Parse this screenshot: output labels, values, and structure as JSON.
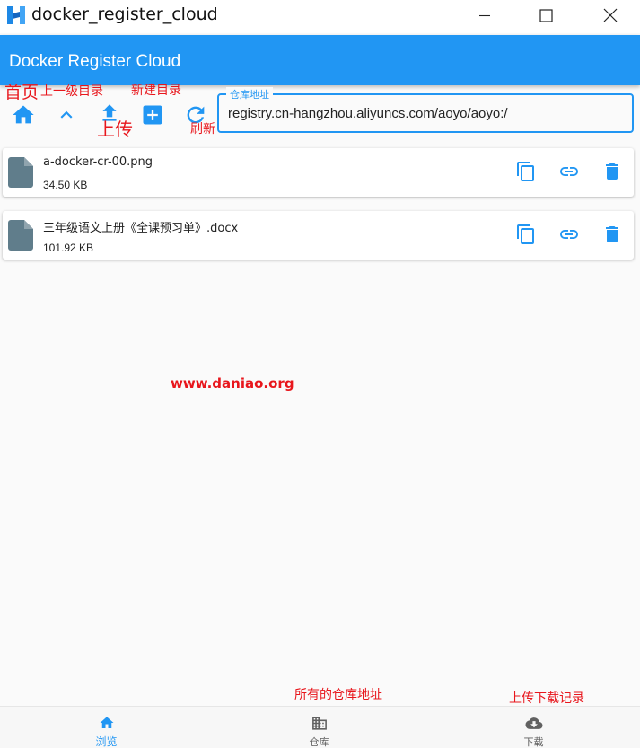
{
  "window": {
    "title": "docker_register_cloud",
    "minimize_label": "minimize",
    "maximize_label": "maximize",
    "close_label": "close"
  },
  "appbar": {
    "title": "Docker Register Cloud"
  },
  "toolbar": {
    "home_icon": "home-icon",
    "up_icon": "chevron-up-icon",
    "upload_icon": "upload-icon",
    "new_folder_icon": "add-box-icon",
    "refresh_icon": "refresh-icon"
  },
  "annotations": {
    "home": "首页",
    "up": "上一级目录",
    "new_folder": "新建目录",
    "upload": "上传",
    "refresh": "刷新",
    "all_repos": "所有的仓库地址",
    "download_records": "上传下载记录",
    "watermark": "www.daniao.org"
  },
  "repo": {
    "label": "仓库地址",
    "value": "registry.cn-hangzhou.aliyuncs.com/aoyo/aoyo:/"
  },
  "files": [
    {
      "name": "a-docker-cr-00.png",
      "size": "34.50 KB"
    },
    {
      "name": "三年级语文上册《全课预习单》.docx",
      "size": "101.92 KB"
    }
  ],
  "file_actions": [
    "copy-icon",
    "link-icon",
    "delete-icon"
  ],
  "bottom_nav": [
    {
      "label": "浏览",
      "icon": "home-icon",
      "active": true
    },
    {
      "label": "仓库",
      "icon": "building-icon",
      "active": false
    },
    {
      "label": "下载",
      "icon": "cloud-download-icon",
      "active": false
    }
  ],
  "colors": {
    "primary": "#2196f3",
    "annotation": "#e8161c",
    "file_icon": "#607d8b",
    "inactive": "#616161"
  }
}
